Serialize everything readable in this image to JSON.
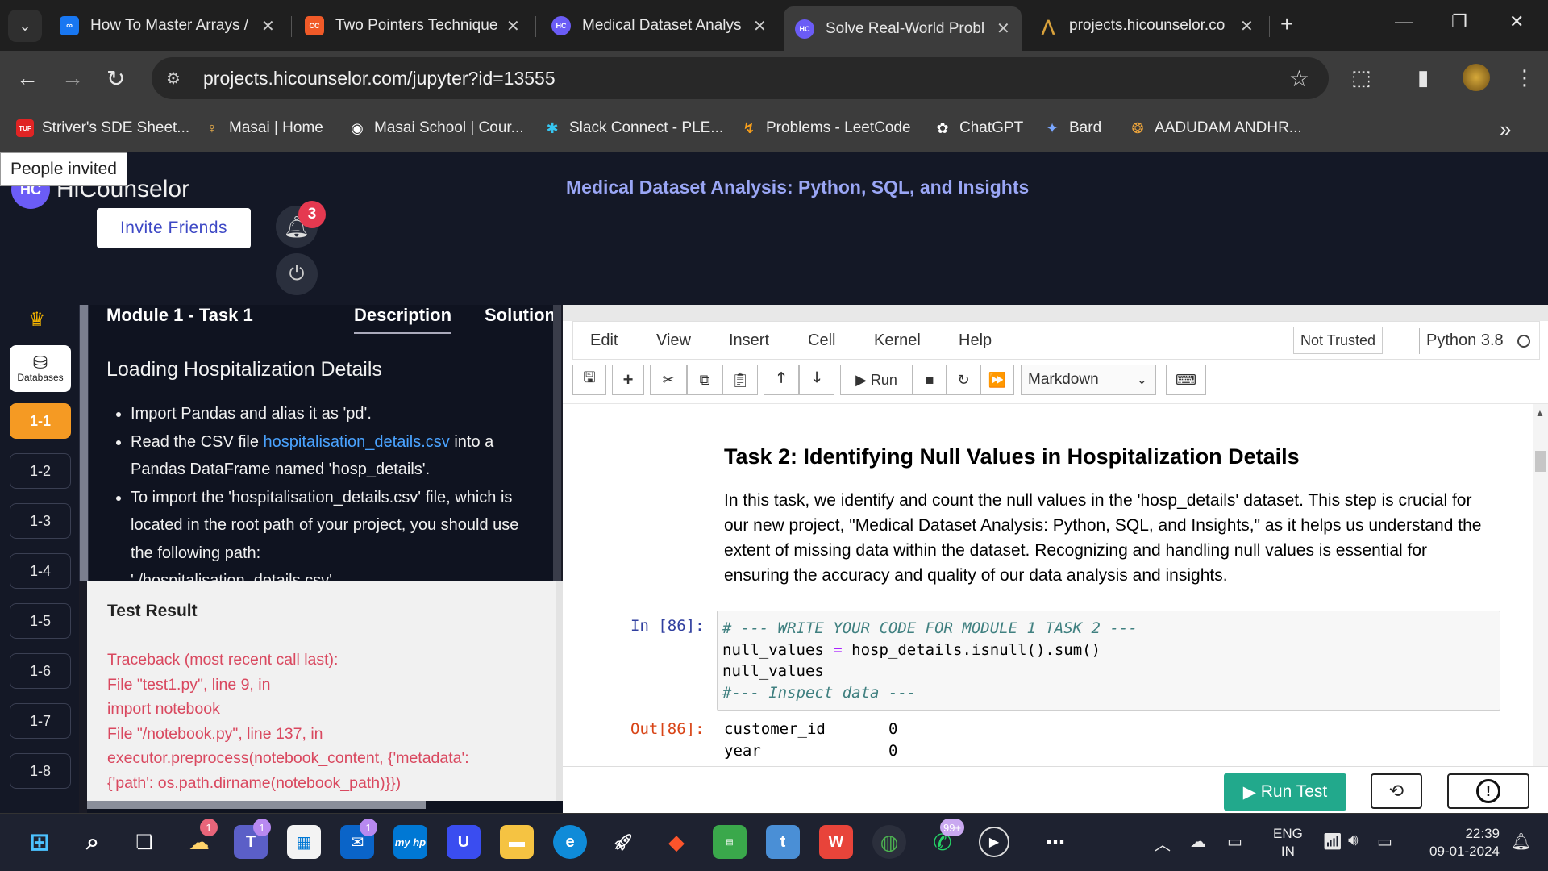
{
  "browser": {
    "tabs": [
      {
        "title": "How To Master Arrays /",
        "icon": "infinity-icon",
        "color": "#1877f2",
        "glyph": "∞"
      },
      {
        "title": "Two Pointers Technique",
        "icon": "code-tab-icon",
        "color": "#f05a28",
        "glyph": "CC"
      },
      {
        "title": "Medical Dataset Analys",
        "icon": "hicounselor-icon",
        "color": "#6b5cf6",
        "glyph": "HC"
      },
      {
        "title": "Solve Real-World Probl",
        "icon": "hicounselor-icon",
        "color": "#6b5cf6",
        "glyph": "HC"
      },
      {
        "title": "projects.hicounselor.co",
        "icon": "site-icon",
        "color": "#d8a13b",
        "glyph": "⋀"
      }
    ],
    "active_tab": 3,
    "url": "projects.hicounselor.com/jupyter?id=13555",
    "bookmarks": [
      {
        "label": "Striver's SDE Sheet...",
        "glyph": "TUF",
        "color": "#e02424"
      },
      {
        "label": "Masai | Home",
        "glyph": "♀",
        "color": "#3c3c3c"
      },
      {
        "label": "Masai School | Cour...",
        "glyph": "◉",
        "color": "#3c3c3c"
      },
      {
        "label": "Slack Connect - PLE...",
        "glyph": "✱",
        "color": "#3c3c3c"
      },
      {
        "label": "Problems - LeetCode",
        "glyph": "↯",
        "color": "#3c3c3c"
      },
      {
        "label": "ChatGPT",
        "glyph": "✿",
        "color": "#3c3c3c"
      },
      {
        "label": "Bard",
        "glyph": "✦",
        "color": "#3c3c3c"
      },
      {
        "label": "AADUDAM ANDHR...",
        "glyph": "❂",
        "color": "#3c3c3c"
      }
    ]
  },
  "app": {
    "tooltip": "People invited",
    "logo_mark": "HC",
    "logo_text": "HiCounselor",
    "invite_label": "Invite Friends",
    "notification_count": "3",
    "project_title": "Medical Dataset Analysis: Python, SQL, and Insights"
  },
  "rail": {
    "databases_label": "Databases",
    "steps": [
      "1-1",
      "1-2",
      "1-3",
      "1-4",
      "1-5",
      "1-6",
      "1-7",
      "1-8"
    ],
    "active_step": "1-1"
  },
  "task": {
    "module_label": "Module 1 - Task 1",
    "tab_description": "Description",
    "tab_solution": "Solution",
    "heading": "Loading Hospitalization Details",
    "bullet1": "Import Pandas and alias it as 'pd'.",
    "bullet2_pre": "Read the CSV file ",
    "bullet2_link": "hospitalisation_details.csv",
    "bullet2_post": " into a Pandas DataFrame named 'hosp_details'.",
    "bullet3": "To import the 'hospitalisation_details.csv' file, which is located in the root path of your project, you should use the following path:",
    "bullet4": "'./hospitalisation_details.csv'"
  },
  "test": {
    "title": "Test Result",
    "lines": [
      "Traceback (most recent call last):",
      "File \"test1.py\", line 9, in",
      "import notebook",
      "File \"/notebook.py\", line 137, in",
      "executor.preprocess(notebook_content, {'metadata':",
      "{'path': os.path.dirname(notebook_path)}})"
    ]
  },
  "jupyter": {
    "menu": [
      "Edit",
      "View",
      "Insert",
      "Cell",
      "Kernel",
      "Help"
    ],
    "trust": "Not Trusted",
    "kernel": "Python 3.8",
    "run_label": "Run",
    "cell_type": "Markdown",
    "md_heading": "Task 2: Identifying Null Values in Hospitalization Details",
    "md_paragraph": "In this task, we identify and count the null values in the 'hosp_details' dataset. This step is crucial for our new project, \"Medical Dataset Analysis: Python, SQL, and Insights,\" as it helps us understand the extent of missing data within the dataset. Recognizing and handling null values is essential for ensuring the accuracy and quality of our data analysis and insights.",
    "in_prompt": "In [86]:",
    "out_prompt": "Out[86]:",
    "code_line1": "# --- WRITE YOUR CODE FOR MODULE 1 TASK 2 ---",
    "code_line2_a": "null_values ",
    "code_line2_op": "=",
    "code_line2_b": " hosp_details.isnull().sum()",
    "code_line3": "null_values",
    "code_line4": "#--- Inspect data ---",
    "output": [
      {
        "col": "customer_id",
        "val": "0"
      },
      {
        "col": "year",
        "val": "0"
      }
    ],
    "run_test_label": "Run Test"
  },
  "taskbar": {
    "weather_badge": "1",
    "teams_badge": "1",
    "mail_badge": "1",
    "whatsapp_badge": "99+",
    "lang_line1": "ENG",
    "lang_line2": "IN",
    "time": "22:39",
    "date": "09-01-2024"
  }
}
